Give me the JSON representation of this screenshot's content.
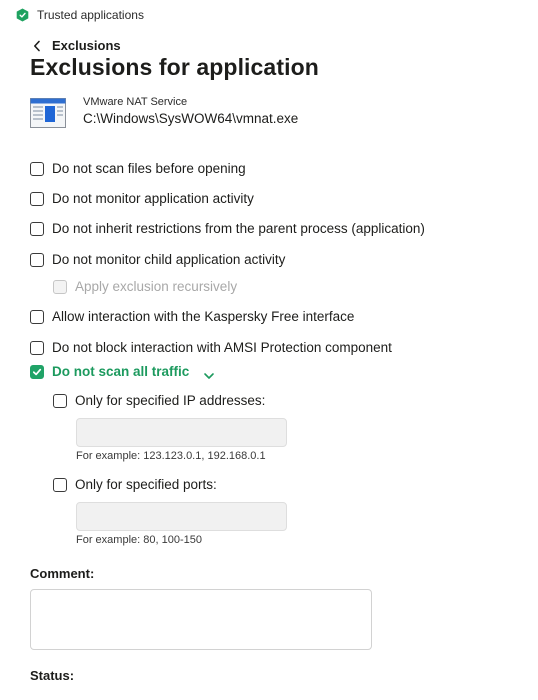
{
  "window": {
    "title": "Trusted applications",
    "icon": "kaspersky-shield-icon",
    "accent_color": "#20a367"
  },
  "header": {
    "back_icon": "chevron-left-icon",
    "back_label": "Exclusions",
    "title": "Exclusions for application"
  },
  "application": {
    "icon": "executable-window-icon",
    "name": "VMware NAT Service",
    "path": "C:\\Windows\\SysWOW64\\vmnat.exe"
  },
  "options": {
    "scan_files": {
      "label": "Do not scan files before opening",
      "checked": false
    },
    "monitor_activity": {
      "label": "Do not monitor application activity",
      "checked": false
    },
    "inherit_restrictions": {
      "label": "Do not inherit restrictions from the parent process (application)",
      "checked": false
    },
    "monitor_child": {
      "label": "Do not monitor child application activity",
      "checked": false
    },
    "recursive": {
      "label": "Apply exclusion recursively",
      "checked": false,
      "disabled": true
    },
    "allow_interaction": {
      "label": "Allow interaction with the Kaspersky Free interface",
      "checked": false
    },
    "amsi": {
      "label": "Do not block interaction with AMSI Protection component",
      "checked": false
    },
    "traffic": {
      "label": "Do not scan all traffic",
      "checked": true,
      "expand_icon": "chevron-down-icon"
    },
    "ip": {
      "label": "Only for specified IP addresses:",
      "checked": false,
      "value": "",
      "hint": "For example: 123.123.0.1, 192.168.0.1"
    },
    "ports": {
      "label": "Only for specified ports:",
      "checked": false,
      "value": "",
      "hint": "For example: 80, 100-150"
    }
  },
  "comment": {
    "label": "Comment:",
    "value": ""
  },
  "status": {
    "label": "Status:"
  }
}
